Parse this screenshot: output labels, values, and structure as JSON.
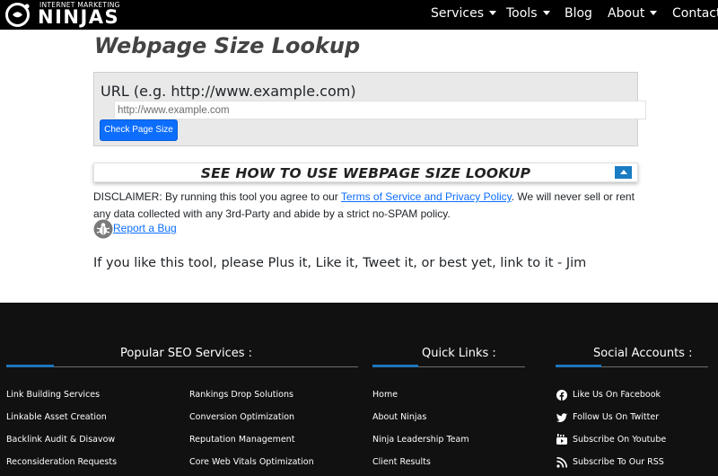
{
  "brand": {
    "small_text": "INTERNET MARKETING",
    "big_text": "NINJAS"
  },
  "nav": {
    "items": [
      {
        "label": "Services",
        "dropdown": true
      },
      {
        "label": "Tools",
        "dropdown": true
      },
      {
        "label": "Blog",
        "dropdown": false
      },
      {
        "label": "About",
        "dropdown": true
      },
      {
        "label": "Contact",
        "dropdown": false
      }
    ]
  },
  "main": {
    "title": "Webpage Size Lookup",
    "url_label": "URL (e.g. http://www.example.com)",
    "url_placeholder": "http://www.example.com",
    "url_value": "",
    "check_button": "Check Page Size",
    "howto_label": "SEE HOW TO USE WEBPAGE SIZE LOOKUP",
    "disclaimer_prefix": "DISCLAIMER: By running this tool you agree to our ",
    "disclaimer_link": "Terms of Service and Privacy Policy",
    "disclaimer_suffix": ". We will never sell or rent any data collected with any 3rd-Party and abide by a strict no-SPAM policy.",
    "report_bug": "Report a Bug",
    "plus_line": "If you like this tool, please Plus it, Like it, Tweet it, or best yet, link to it - Jim"
  },
  "footer": {
    "popular_heading": "Popular SEO Services :",
    "quick_heading": "Quick Links :",
    "social_heading": "Social Accounts :",
    "popular_col1": [
      "Link Building Services",
      "Linkable Asset Creation",
      "Backlink Audit & Disavow",
      "Reconsideration Requests"
    ],
    "popular_col2": [
      "Rankings Drop Solutions",
      "Conversion Optimization",
      "Reputation Management",
      "Core Web Vitals Optimization"
    ],
    "quick_links": [
      "Home",
      "About Ninjas",
      "Ninja Leadership Team",
      "Client Results"
    ],
    "social": [
      {
        "label": "Like Us On Facebook",
        "icon": "facebook-icon"
      },
      {
        "label": "Follow Us On Twitter",
        "icon": "twitter-icon"
      },
      {
        "label": "Subscribe On Youtube",
        "icon": "youtube-icon"
      },
      {
        "label": "Subscribe To Our RSS",
        "icon": "rss-icon"
      }
    ]
  },
  "colors": {
    "accent": "#0d6efd",
    "footer_bg": "#111111",
    "toggle_blue": "#1a7cc2"
  }
}
